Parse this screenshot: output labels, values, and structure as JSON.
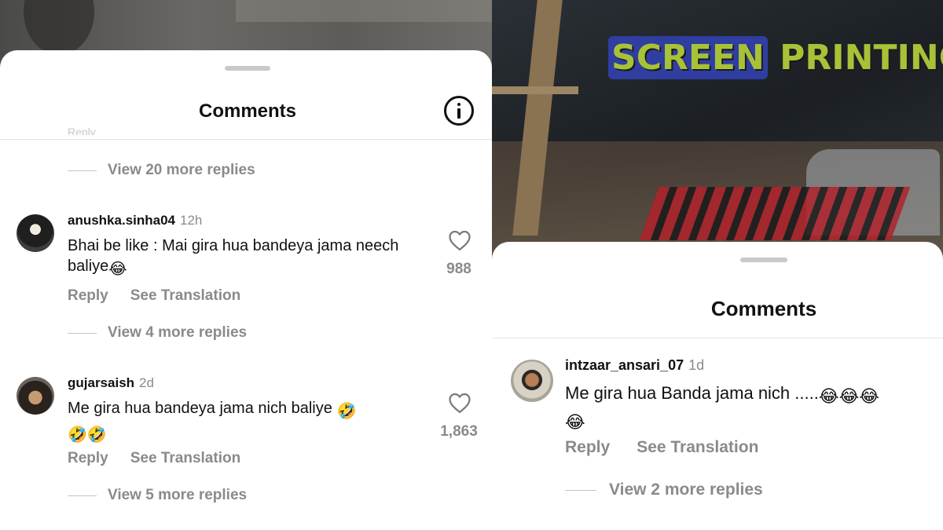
{
  "left_panel": {
    "sheet_title": "Comments",
    "cut_off_text": "Reply",
    "top_replies_link": "View 20 more replies",
    "comments": [
      {
        "username": "anushka.sinha04",
        "time": "12h",
        "text": "Bhai be like : Mai gira hua bandeya jama neech baliye",
        "emoji": "😂",
        "likes": "988",
        "reply_label": "Reply",
        "translate_label": "See Translation",
        "view_replies": "View 4 more replies"
      },
      {
        "username": "gujarsaish",
        "time": "2d",
        "text": "Me gira hua bandeya jama nich baliye",
        "emoji": "🤣",
        "emoji_line2": "🤣🤣",
        "likes": "1,863",
        "reply_label": "Reply",
        "translate_label": "See Translation",
        "view_replies": "View 5 more replies"
      }
    ]
  },
  "right_panel": {
    "video_overlay_text_1": "SCREEN",
    "video_overlay_text_2": "PRINTING",
    "sheet_title": "Comments",
    "comment": {
      "username": "intzaar_ansari_07",
      "time": "1d",
      "text": "Me gira hua Banda jama nich .....",
      "emoji": "😂😂😂",
      "emoji_line2": "😂",
      "reply_label": "Reply",
      "translate_label": "See Translation",
      "view_replies": "View 2 more replies"
    }
  },
  "colors": {
    "sheet_bg": "#ffffff",
    "muted_text": "#8a8a8a",
    "primary_text": "#111111",
    "overlay_green": "#a8c238",
    "overlay_blue": "#2f3ea0"
  },
  "icons": [
    "info-icon",
    "heart-icon",
    "avatar"
  ]
}
